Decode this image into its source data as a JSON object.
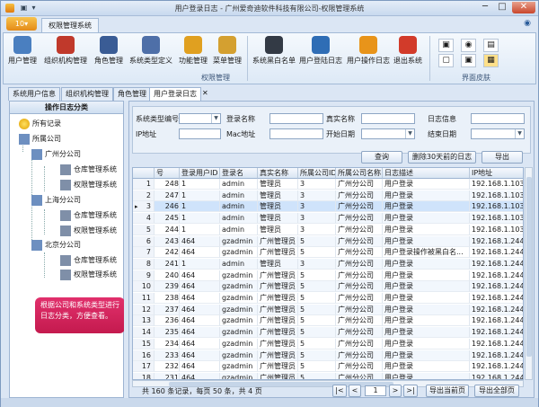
{
  "window": {
    "title": "用户登录日志 - 广州爱奇迪软件科技有限公司-权限管理系统",
    "qat_save": "▣",
    "qat_dropdown": "▾",
    "min": "─",
    "max": "□",
    "close": "✕"
  },
  "menubar": {
    "app_menu": "10▾",
    "ribbon_tab": "权限管理系统",
    "help": "◉"
  },
  "ribbon": {
    "buttons": [
      {
        "label": "用户管理",
        "color": "#4a7fc0"
      },
      {
        "label": "组织机构管理",
        "color": "#c0392b"
      },
      {
        "label": "角色管理",
        "color": "#3a5c95"
      },
      {
        "label": "系统类型定义",
        "color": "#4e6fa8"
      },
      {
        "label": "功能管理",
        "color": "#e0a020"
      },
      {
        "label": "菜单管理",
        "color": "#d4a030"
      },
      {
        "label": "系统黑白名单",
        "color": "#333a45"
      },
      {
        "label": "用户登陆日志",
        "color": "#2f6db5"
      },
      {
        "label": "用户操作日志",
        "color": "#e8941a"
      },
      {
        "label": "退出系统",
        "color": "#d23b2a"
      }
    ],
    "group_label": "权限管理",
    "skin_label": "界面皮肤",
    "skins": [
      "▣",
      "◉",
      "▤",
      "▢",
      "▣",
      "▦"
    ]
  },
  "doc_tabs": [
    {
      "label": "系统用户信息"
    },
    {
      "label": "组织机构管理"
    },
    {
      "label": "角色管理"
    },
    {
      "label": "用户登录日志"
    },
    {
      "label": "✕"
    }
  ],
  "left_panel": {
    "header": "操作日志分类",
    "nodes": [
      {
        "label": "所有记录"
      },
      {
        "label": "所属公司"
      },
      {
        "label": "广州分公司"
      },
      {
        "label": "仓库管理系统"
      },
      {
        "label": "权限管理系统"
      },
      {
        "label": "上海分公司"
      },
      {
        "label": "仓库管理系统"
      },
      {
        "label": "权限管理系统"
      },
      {
        "label": "北京分公司"
      },
      {
        "label": "仓库管理系统"
      },
      {
        "label": "权限管理系统"
      }
    ],
    "callout": "根据公司和系统类型进行日志分类，方便查看。"
  },
  "filters": {
    "system_type": "系统类型编号",
    "login_name": "登录名称",
    "real_name": "真实名称",
    "log_info": "日志信息",
    "ip": "IP地址",
    "mac": "Mac地址",
    "start_date": "开始日期",
    "end_date": "结束日期",
    "query_btn": "查询",
    "delete_btn": "删除30天前的日志",
    "export_btn": "导出"
  },
  "grid": {
    "columns": [
      "",
      "号",
      "登录用户ID",
      "登录名",
      "真实名称",
      "所属公司ID",
      "所属公司名称",
      "日志描述",
      "IP地址"
    ],
    "rows": [
      [
        "1",
        "248",
        "1",
        "admin",
        "管理员",
        "3",
        "广州分公司",
        "用户登录",
        "192.168.1.103"
      ],
      [
        "2",
        "247",
        "1",
        "admin",
        "管理员",
        "3",
        "广州分公司",
        "用户登录",
        "192.168.1.103"
      ],
      [
        "3",
        "246",
        "1",
        "admin",
        "管理员",
        "3",
        "广州分公司",
        "用户登录",
        "192.168.1.103"
      ],
      [
        "4",
        "245",
        "1",
        "admin",
        "管理员",
        "3",
        "广州分公司",
        "用户登录",
        "192.168.1.103"
      ],
      [
        "5",
        "244",
        "1",
        "admin",
        "管理员",
        "3",
        "广州分公司",
        "用户登录",
        "192.168.1.103"
      ],
      [
        "6",
        "243",
        "464",
        "gzadmin",
        "广州管理员",
        "5",
        "广州分公司",
        "用户登录",
        "192.168.1.244"
      ],
      [
        "7",
        "242",
        "464",
        "gzadmin",
        "广州管理员",
        "5",
        "广州分公司",
        "用户登录操作被黑白名...",
        "192.168.1.244"
      ],
      [
        "8",
        "241",
        "1",
        "admin",
        "管理员",
        "3",
        "广州分公司",
        "用户登录",
        "192.168.1.244"
      ],
      [
        "9",
        "240",
        "464",
        "gzadmin",
        "广州管理员",
        "5",
        "广州分公司",
        "用户登录",
        "192.168.1.244"
      ],
      [
        "10",
        "239",
        "464",
        "gzadmin",
        "广州管理员",
        "5",
        "广州分公司",
        "用户登录",
        "192.168.1.244"
      ],
      [
        "11",
        "238",
        "464",
        "gzadmin",
        "广州管理员",
        "5",
        "广州分公司",
        "用户登录",
        "192.168.1.244"
      ],
      [
        "12",
        "237",
        "464",
        "gzadmin",
        "广州管理员",
        "5",
        "广州分公司",
        "用户登录",
        "192.168.1.244"
      ],
      [
        "13",
        "236",
        "464",
        "gzadmin",
        "广州管理员",
        "5",
        "广州分公司",
        "用户登录",
        "192.168.1.244"
      ],
      [
        "14",
        "235",
        "464",
        "gzadmin",
        "广州管理员",
        "5",
        "广州分公司",
        "用户登录",
        "192.168.1.244"
      ],
      [
        "15",
        "234",
        "464",
        "gzadmin",
        "广州管理员",
        "5",
        "广州分公司",
        "用户登录",
        "192.168.1.244"
      ],
      [
        "16",
        "233",
        "464",
        "gzadmin",
        "广州管理员",
        "5",
        "广州分公司",
        "用户登录",
        "192.168.1.244"
      ],
      [
        "17",
        "232",
        "464",
        "gzadmin",
        "广州管理员",
        "5",
        "广州分公司",
        "用户登录",
        "192.168.1.244"
      ],
      [
        "18",
        "231",
        "464",
        "gzadmin",
        "广州管理员",
        "5",
        "广州分公司",
        "用户登录",
        "192.168.1.244"
      ]
    ],
    "current_row_marker": "▸"
  },
  "pager": {
    "summary": "共 160 条记录，每页 50 条，共 4 页",
    "first": "|<",
    "prev": "<",
    "page": "1",
    "next": ">",
    "last": ">|",
    "export_page": "导出当前页",
    "export_all": "导出全部页"
  }
}
